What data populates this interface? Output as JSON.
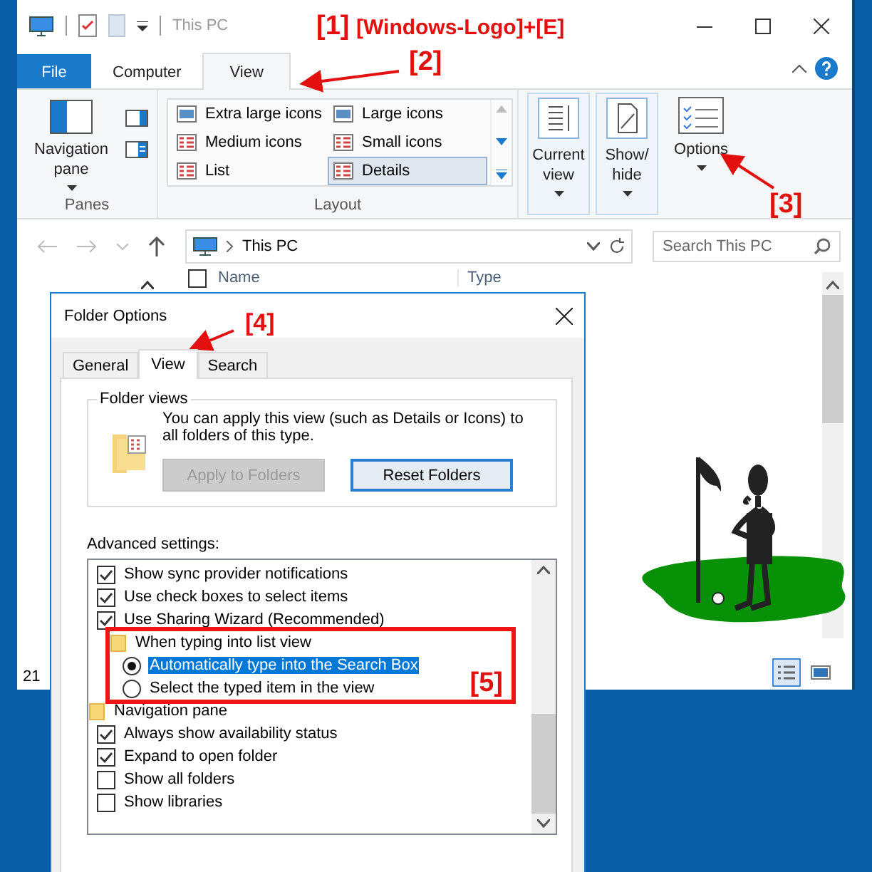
{
  "explorer": {
    "title": "This PC",
    "tabs": [
      {
        "label": "File",
        "kind": "file",
        "selected": false
      },
      {
        "label": "Computer",
        "kind": "tab",
        "selected": false
      },
      {
        "label": "View",
        "kind": "tab",
        "selected": true
      }
    ],
    "ribbon": {
      "panes": {
        "button": "Navigation pane",
        "group": "Panes"
      },
      "layout": {
        "group": "Layout",
        "items": [
          {
            "label": "Extra large icons",
            "selected": false
          },
          {
            "label": "Large icons",
            "selected": false
          },
          {
            "label": "Medium icons",
            "selected": false
          },
          {
            "label": "Small icons",
            "selected": false
          },
          {
            "label": "List",
            "selected": false
          },
          {
            "label": "Details",
            "selected": true
          }
        ]
      },
      "buttons": [
        {
          "label": "Current view",
          "kind": "current"
        },
        {
          "label": "Show/ hide",
          "kind": "showhide"
        },
        {
          "label": "Options",
          "kind": "options"
        }
      ]
    },
    "address": "This PC",
    "search": {
      "placeholder": "Search This PC"
    },
    "select_all": {
      "checked": false
    },
    "columns": [
      "Name",
      "Type"
    ],
    "status": "21",
    "view_buttons": [
      {
        "kind": "details",
        "selected": true
      },
      {
        "kind": "thumbnails",
        "selected": false
      }
    ]
  },
  "dialog": {
    "title": "Folder Options",
    "tabs": [
      {
        "label": "General",
        "selected": false
      },
      {
        "label": "View",
        "selected": true
      },
      {
        "label": "Search",
        "selected": false
      }
    ],
    "folder_views": {
      "legend": "Folder views",
      "text": "You can apply this view (such as Details or Icons) to all folders of this type.",
      "buttons": [
        {
          "label": "Apply to Folders",
          "disabled": true
        },
        {
          "label": "Reset Folders",
          "disabled": false
        }
      ]
    },
    "advanced_label": "Advanced settings:",
    "settings": [
      {
        "kind": "group",
        "children": [
          {
            "kind": "checkbox",
            "label": "Show sync provider notifications",
            "checked": true
          },
          {
            "kind": "checkbox",
            "label": "Use check boxes to select items",
            "checked": true
          },
          {
            "kind": "checkbox",
            "label": "Use Sharing Wizard (Recommended)",
            "checked": true
          },
          {
            "kind": "group",
            "label": "When typing into list view",
            "highlighted": true,
            "note": "[5]",
            "children": [
              {
                "kind": "radio",
                "label": "Automatically type into the Search Box",
                "checked": true,
                "selected": true
              },
              {
                "kind": "radio",
                "label": "Select the typed item in the view",
                "checked": false,
                "selected": false
              }
            ]
          }
        ]
      },
      {
        "kind": "group",
        "label": "Navigation pane",
        "children": [
          {
            "kind": "checkbox",
            "label": "Always show availability status",
            "checked": true
          },
          {
            "kind": "checkbox",
            "label": "Expand to open folder",
            "checked": true
          },
          {
            "kind": "checkbox",
            "label": "Show all folders",
            "checked": false
          },
          {
            "kind": "checkbox",
            "label": "Show libraries",
            "checked": false
          }
        ]
      }
    ]
  },
  "annotations": [
    {
      "text": "[1]"
    },
    {
      "text": "[Windows-Logo]+[E]"
    },
    {
      "text": "[2]"
    },
    {
      "text": "[3]"
    },
    {
      "text": "[4]"
    }
  ]
}
